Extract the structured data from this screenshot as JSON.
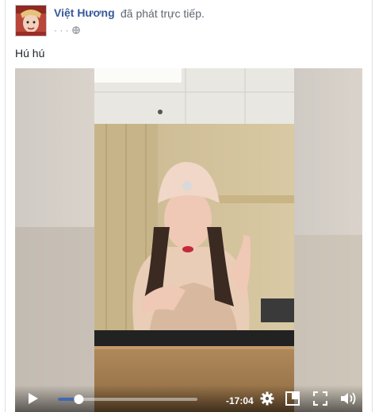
{
  "post": {
    "author": "Việt Hương",
    "action": "đã phát trực tiếp.",
    "timestamp": "· · ·",
    "privacy_icon": "globe-icon",
    "status_text": "Hú hú"
  },
  "video": {
    "time_remaining": "-17:04",
    "progress": 0.15,
    "volume_level": 1.0,
    "icons": [
      "play-icon",
      "settings-icon",
      "expand-icon",
      "fullscreen-icon",
      "volume-icon"
    ]
  },
  "colors": {
    "author_link": "#365899",
    "progress_fill": "#4267b2",
    "text_secondary": "#616770",
    "border": "#dddfe2"
  }
}
